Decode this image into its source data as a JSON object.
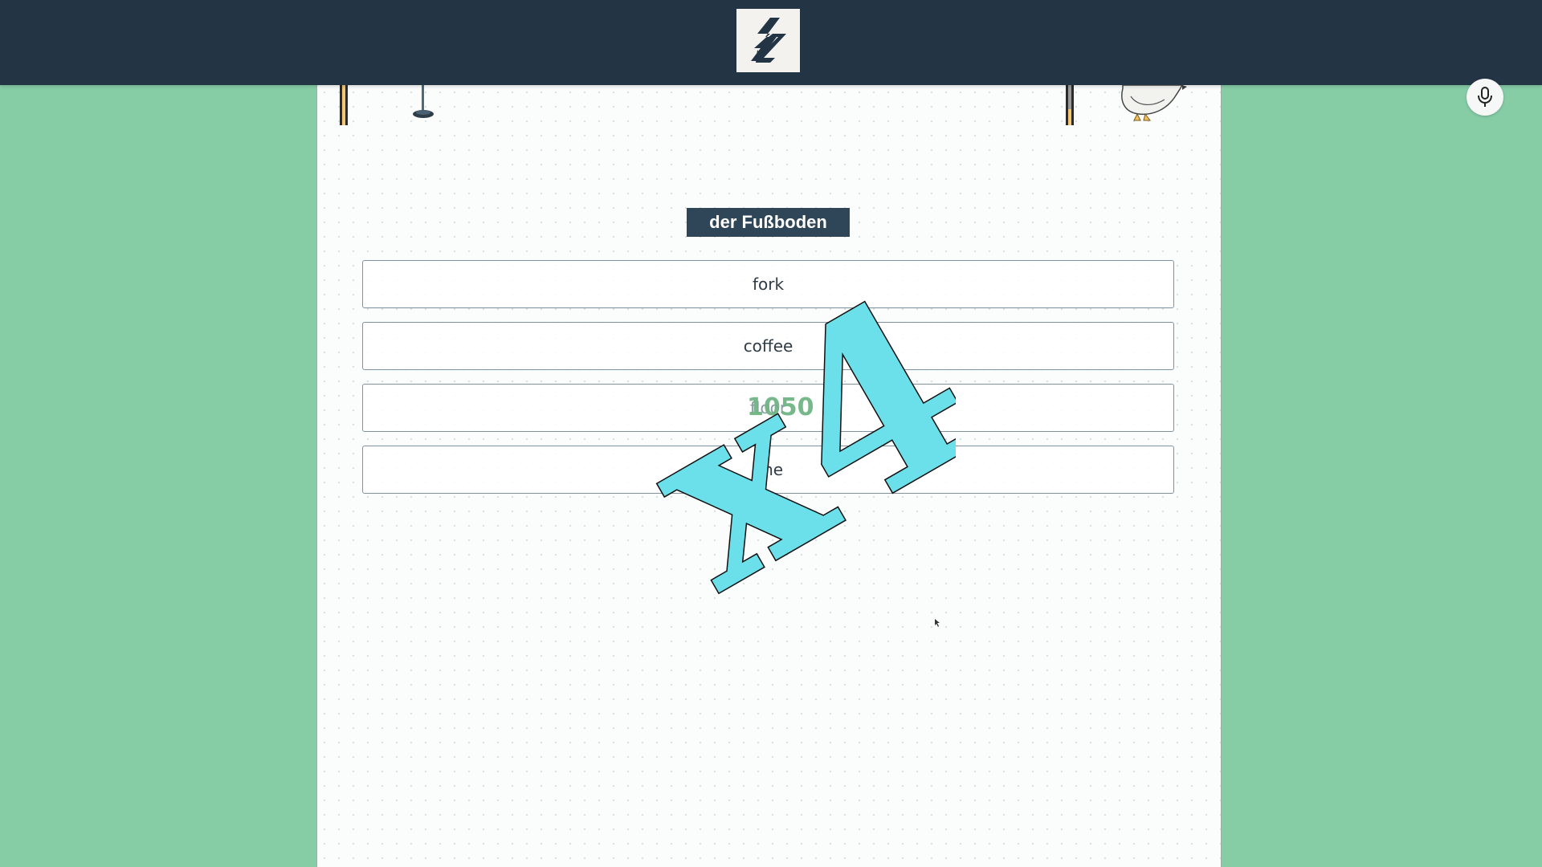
{
  "header": {
    "logo_icon": "lightning-arrow-logo-icon"
  },
  "quiz": {
    "prompt_word": "der Fußboden",
    "options": [
      {
        "label": "fork"
      },
      {
        "label": "coffee"
      },
      {
        "label": "floor"
      },
      {
        "label": "one"
      }
    ],
    "score_popup": "1050",
    "multiplier": "x4"
  },
  "mic": {
    "icon": "microphone-icon"
  },
  "colors": {
    "header_bg": "#233445",
    "page_bg": "#86cda6",
    "badge_bg": "#2f4658",
    "multiplier": "#6ce0ea",
    "score_popup": "#6fb583"
  }
}
